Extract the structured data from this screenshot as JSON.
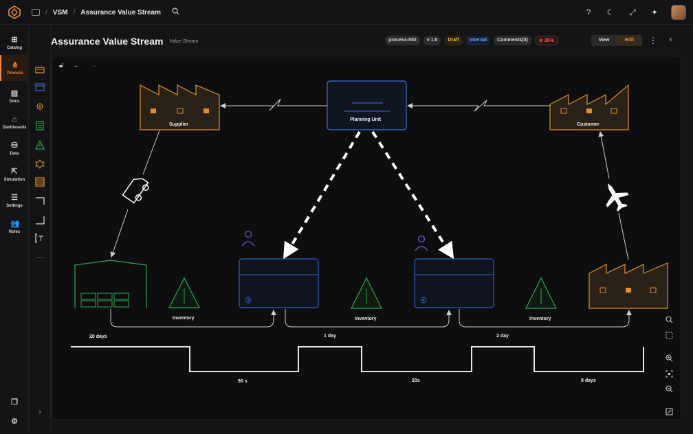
{
  "app": {
    "breadcrumb": [
      "VSM",
      "Assurance Value Stream"
    ]
  },
  "topbar": {
    "icons": [
      "search-icon",
      "help-icon",
      "moon-icon",
      "fullscreen-icon",
      "sparkle-icon"
    ]
  },
  "sidebar": {
    "items": [
      {
        "label": "Catalog",
        "icon": "catalog-icon"
      },
      {
        "label": "Process",
        "icon": "process-icon",
        "active": true
      },
      {
        "label": "Docs",
        "icon": "docs-icon"
      },
      {
        "label": "Dashboards",
        "icon": "dashboards-icon"
      },
      {
        "label": "Data",
        "icon": "database-icon"
      },
      {
        "label": "Simulation",
        "icon": "simulation-icon"
      },
      {
        "label": "Settings",
        "icon": "settings-icon"
      },
      {
        "label": "Roles",
        "icon": "roles-icon"
      }
    ]
  },
  "page": {
    "title": "Assurance Value Stream",
    "subtitle": "Value Stream",
    "badges": {
      "process_id": "process-002",
      "version": "v 1.0",
      "status": "Draft",
      "visibility": "Internal",
      "comments": "Comments(0)",
      "progress": "35%"
    },
    "mode": {
      "view": "View",
      "edit": "Edit",
      "selected": "Edit"
    }
  },
  "diagram": {
    "supplier_label": "Supplier",
    "planning_label": "Planning Unit",
    "customer_label": "Customer",
    "inventory_labels": [
      "Inventory",
      "Inventory",
      "Inventory"
    ],
    "waiting_times": [
      "20 days",
      "1 day",
      "2 day"
    ],
    "process_times": [
      "90 s",
      "20s",
      "8 days"
    ],
    "colors": {
      "factory": "#e0902f",
      "planning": "#3b6fd6",
      "warehouse": "#35a84a",
      "process_box": "#2f5fb8",
      "triangle": "#35a84a",
      "operator": "#6a5fd0",
      "line": "#cfcfcf"
    }
  }
}
